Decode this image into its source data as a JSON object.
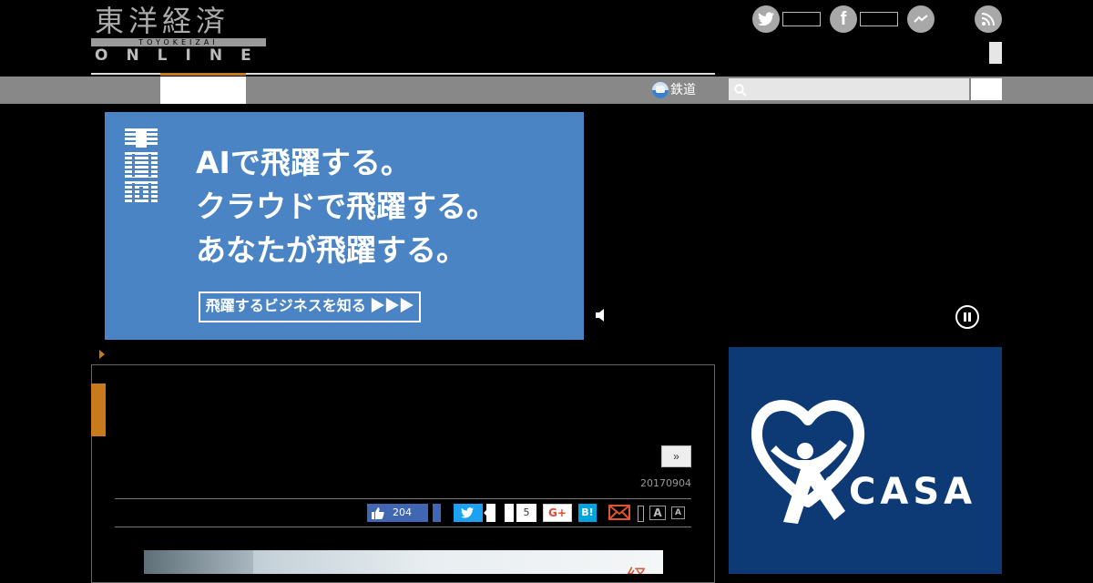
{
  "header": {
    "logo_jp": "東洋経済",
    "logo_romaji": "TOYOKEIZAI",
    "logo_online": "ONLINE"
  },
  "social": [
    {
      "name": "twitter",
      "icon": "twitter-bird-icon"
    },
    {
      "name": "facebook",
      "icon": "facebook-f-icon"
    },
    {
      "name": "messenger",
      "icon": "messenger-icon"
    },
    {
      "name": "rss",
      "icon": "rss-icon"
    }
  ],
  "nav": {
    "rail_label": "鉄道",
    "search_placeholder": ""
  },
  "ad_banner": {
    "brand": "IBM",
    "lines": [
      "AIで飛躍する。",
      "クラウドで飛躍する。",
      "あなたが飛躍する。"
    ],
    "cta": "飛躍するビジネスを知る ▶▶▶",
    "color": "#4a84c4"
  },
  "article": {
    "next_page_label": "»",
    "date": "20170904",
    "share": {
      "like_count": "204",
      "gplus_count": "5",
      "gplus_label": "G+",
      "hatena_label": "B!",
      "font_large_label": "A",
      "font_small_label": "A"
    },
    "accent_color": "#c97a1c"
  },
  "right_ad": {
    "brand": "CASA",
    "reg_mark": "®",
    "color": "#0d3974"
  }
}
